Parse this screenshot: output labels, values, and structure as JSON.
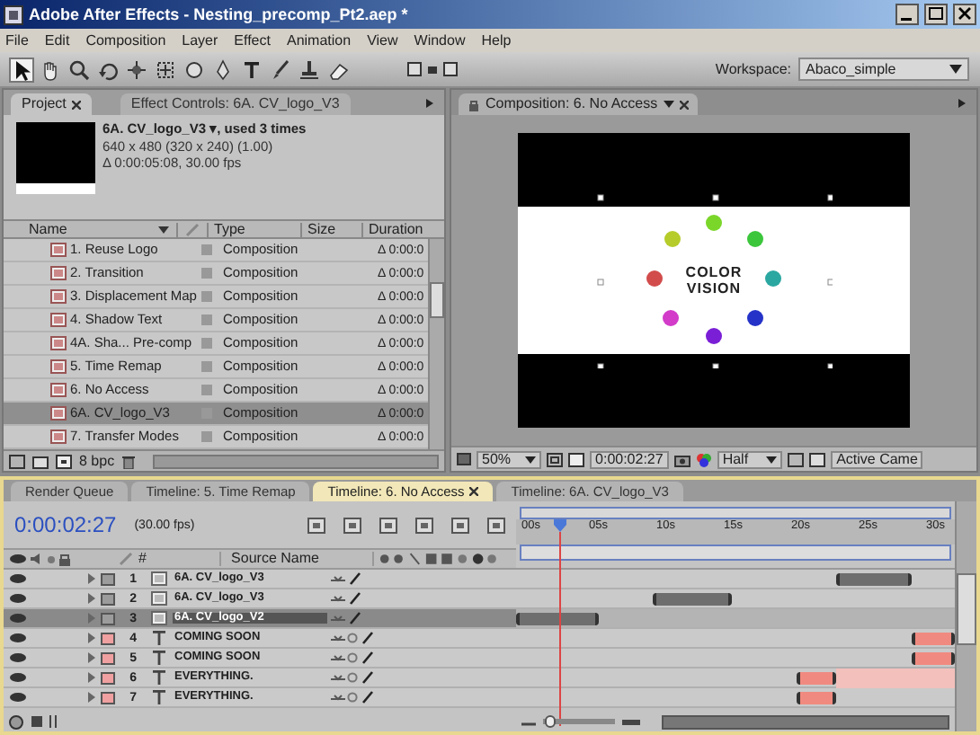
{
  "window": {
    "title": "Adobe After Effects - Nesting_precomp_Pt2.aep *"
  },
  "menu": [
    "File",
    "Edit",
    "Composition",
    "Layer",
    "Effect",
    "Animation",
    "View",
    "Window",
    "Help"
  ],
  "toolbar": {
    "workspace_label": "Workspace:",
    "workspace": "Abaco_simple"
  },
  "project_panel": {
    "tabs": [
      {
        "label": "Project",
        "selected": true
      },
      {
        "label": "Effect Controls: 6A. CV_logo_V3",
        "selected": false
      }
    ],
    "info": [
      "6A. CV_logo_V3 ▾, used 3 times",
      "640 x 480 (320 x 240) (1.00)",
      "Δ 0:00:05:08, 30.00 fps"
    ],
    "columns": [
      "Name",
      "Type",
      "Size",
      "Duration"
    ],
    "rows": [
      {
        "name": "1. Reuse Logo",
        "type": "Composition",
        "duration": "Δ 0:00:0",
        "selected": false
      },
      {
        "name": "2. Transition",
        "type": "Composition",
        "duration": "Δ 0:00:0",
        "selected": false
      },
      {
        "name": "3. Displacement Map",
        "type": "Composition",
        "duration": "Δ 0:00:0",
        "selected": false
      },
      {
        "name": "4. Shadow Text",
        "type": "Composition",
        "duration": "Δ 0:00:0",
        "selected": false
      },
      {
        "name": "4A. Sha... Pre-comp",
        "type": "Composition",
        "duration": "Δ 0:00:0",
        "selected": false
      },
      {
        "name": "5. Time Remap",
        "type": "Composition",
        "duration": "Δ 0:00:0",
        "selected": false
      },
      {
        "name": "6. No Access",
        "type": "Composition",
        "duration": "Δ 0:00:0",
        "selected": false
      },
      {
        "name": "6A. CV_logo_V3",
        "type": "Composition",
        "duration": "Δ 0:00:0",
        "selected": true
      },
      {
        "name": "7. Transfer Modes",
        "type": "Composition",
        "duration": "Δ 0:00:0",
        "selected": false
      }
    ],
    "footer": "8 bpc"
  },
  "composition_panel": {
    "tab": "Composition: 6. No Access",
    "title_lines": [
      "COLOR",
      "VISION"
    ],
    "zoom": "50%",
    "timecode": "0:00:02:27",
    "resolution": "Half",
    "camera": "Active Came"
  },
  "timeline": {
    "tabs": [
      {
        "label": "Render Queue",
        "selected": false
      },
      {
        "label": "Timeline: 5. Time Remap",
        "selected": false
      },
      {
        "label": "Timeline: 6. No Access",
        "selected": true
      },
      {
        "label": "Timeline: 6A. CV_logo_V3",
        "selected": false
      }
    ],
    "timecode": "0:00:02:27",
    "fps": "(30.00 fps)",
    "columns": [
      "#",
      "Source Name"
    ],
    "zoom_slider": {
      "level": 0.1
    },
    "ruler": [
      "00s",
      "05s",
      "10s",
      "15s",
      "20s",
      "25s",
      "30s"
    ],
    "layers": [
      {
        "number": "1",
        "name": "6A. CV_logo_V3",
        "kind": "comp",
        "color": "#9c9c9c",
        "selected": false
      },
      {
        "number": "2",
        "name": "6A. CV_logo_V3",
        "kind": "comp",
        "color": "#9c9c9c",
        "selected": false
      },
      {
        "number": "3",
        "name": "6A. CV_logo_V2",
        "kind": "comp",
        "color": "#9c9c9c",
        "selected": true
      },
      {
        "number": "4",
        "name": "COMING SOON",
        "kind": "text",
        "color": "#f0a0a0",
        "selected": false
      },
      {
        "number": "5",
        "name": "COMING SOON",
        "kind": "text",
        "color": "#f0a0a0",
        "selected": false
      },
      {
        "number": "6",
        "name": "EVERYTHING.",
        "kind": "text",
        "color": "#f0a0a0",
        "selected": false
      },
      {
        "number": "7",
        "name": "EVERYTHING.",
        "kind": "text",
        "color": "#f0a0a0",
        "selected": false
      }
    ]
  }
}
